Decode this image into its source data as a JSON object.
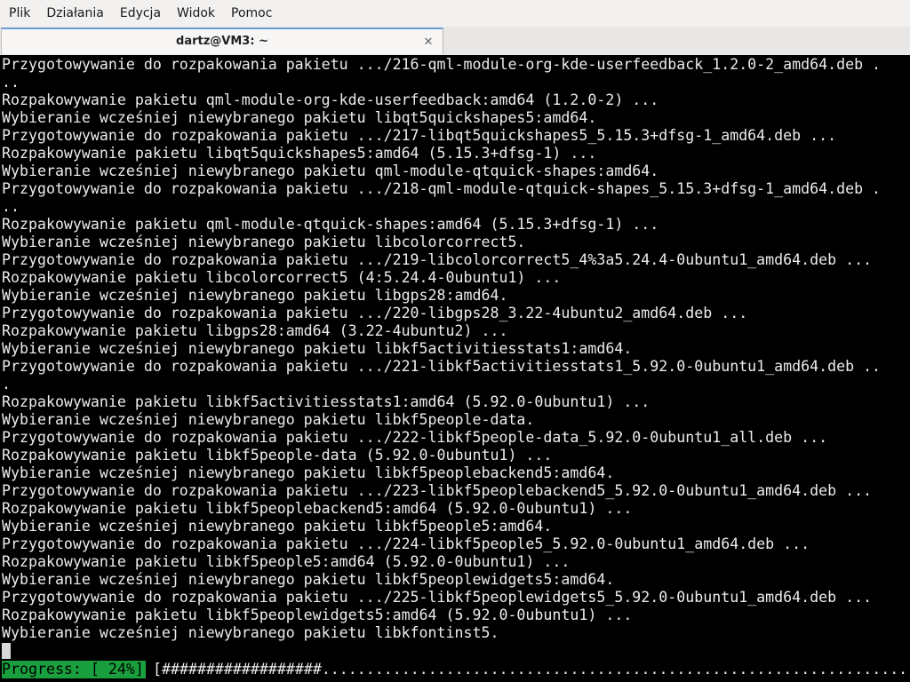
{
  "menu": [
    "Plik",
    "Działania",
    "Edycja",
    "Widok",
    "Pomoc"
  ],
  "tab": {
    "title": "dartz@VM3: ~",
    "close_glyph": "✕"
  },
  "terminal": {
    "lines": [
      "Przygotowywanie do rozpakowania pakietu .../216-qml-module-org-kde-userfeedback_1.2.0-2_amd64.deb .",
      "..",
      "Rozpakowywanie pakietu qml-module-org-kde-userfeedback:amd64 (1.2.0-2) ...",
      "Wybieranie wcześniej niewybranego pakietu libqt5quickshapes5:amd64.",
      "Przygotowywanie do rozpakowania pakietu .../217-libqt5quickshapes5_5.15.3+dfsg-1_amd64.deb ...",
      "Rozpakowywanie pakietu libqt5quickshapes5:amd64 (5.15.3+dfsg-1) ...",
      "Wybieranie wcześniej niewybranego pakietu qml-module-qtquick-shapes:amd64.",
      "Przygotowywanie do rozpakowania pakietu .../218-qml-module-qtquick-shapes_5.15.3+dfsg-1_amd64.deb .",
      "..",
      "Rozpakowywanie pakietu qml-module-qtquick-shapes:amd64 (5.15.3+dfsg-1) ...",
      "Wybieranie wcześniej niewybranego pakietu libcolorcorrect5.",
      "Przygotowywanie do rozpakowania pakietu .../219-libcolorcorrect5_4%3a5.24.4-0ubuntu1_amd64.deb ...",
      "Rozpakowywanie pakietu libcolorcorrect5 (4:5.24.4-0ubuntu1) ...",
      "Wybieranie wcześniej niewybranego pakietu libgps28:amd64.",
      "Przygotowywanie do rozpakowania pakietu .../220-libgps28_3.22-4ubuntu2_amd64.deb ...",
      "Rozpakowywanie pakietu libgps28:amd64 (3.22-4ubuntu2) ...",
      "Wybieranie wcześniej niewybranego pakietu libkf5activitiesstats1:amd64.",
      "Przygotowywanie do rozpakowania pakietu .../221-libkf5activitiesstats1_5.92.0-0ubuntu1_amd64.deb ..",
      ".",
      "Rozpakowywanie pakietu libkf5activitiesstats1:amd64 (5.92.0-0ubuntu1) ...",
      "Wybieranie wcześniej niewybranego pakietu libkf5people-data.",
      "Przygotowywanie do rozpakowania pakietu .../222-libkf5people-data_5.92.0-0ubuntu1_all.deb ...",
      "Rozpakowywanie pakietu libkf5people-data (5.92.0-0ubuntu1) ...",
      "Wybieranie wcześniej niewybranego pakietu libkf5peoplebackend5:amd64.",
      "Przygotowywanie do rozpakowania pakietu .../223-libkf5peoplebackend5_5.92.0-0ubuntu1_amd64.deb ...",
      "Rozpakowywanie pakietu libkf5peoplebackend5:amd64 (5.92.0-0ubuntu1) ...",
      "Wybieranie wcześniej niewybranego pakietu libkf5people5:amd64.",
      "Przygotowywanie do rozpakowania pakietu .../224-libkf5people5_5.92.0-0ubuntu1_amd64.deb ...",
      "Rozpakowywanie pakietu libkf5people5:amd64 (5.92.0-0ubuntu1) ...",
      "Wybieranie wcześniej niewybranego pakietu libkf5peoplewidgets5:amd64.",
      "Przygotowywanie do rozpakowania pakietu .../225-libkf5peoplewidgets5_5.92.0-0ubuntu1_amd64.deb ...",
      "Rozpakowywanie pakietu libkf5peoplewidgets5:amd64 (5.92.0-0ubuntu1) ...",
      "Wybieranie wcześniej niewybranego pakietu libkfontinst5."
    ],
    "progress_label": "Progress: [ 24%]",
    "progress_bar": "[##################.................................................................................]",
    "progress_percent": 24
  },
  "colors": {
    "terminal_bg": "#000000",
    "terminal_fg": "#ececec",
    "progress_bg": "#1a9f3e",
    "tab_accent": "#6a9fd4"
  }
}
